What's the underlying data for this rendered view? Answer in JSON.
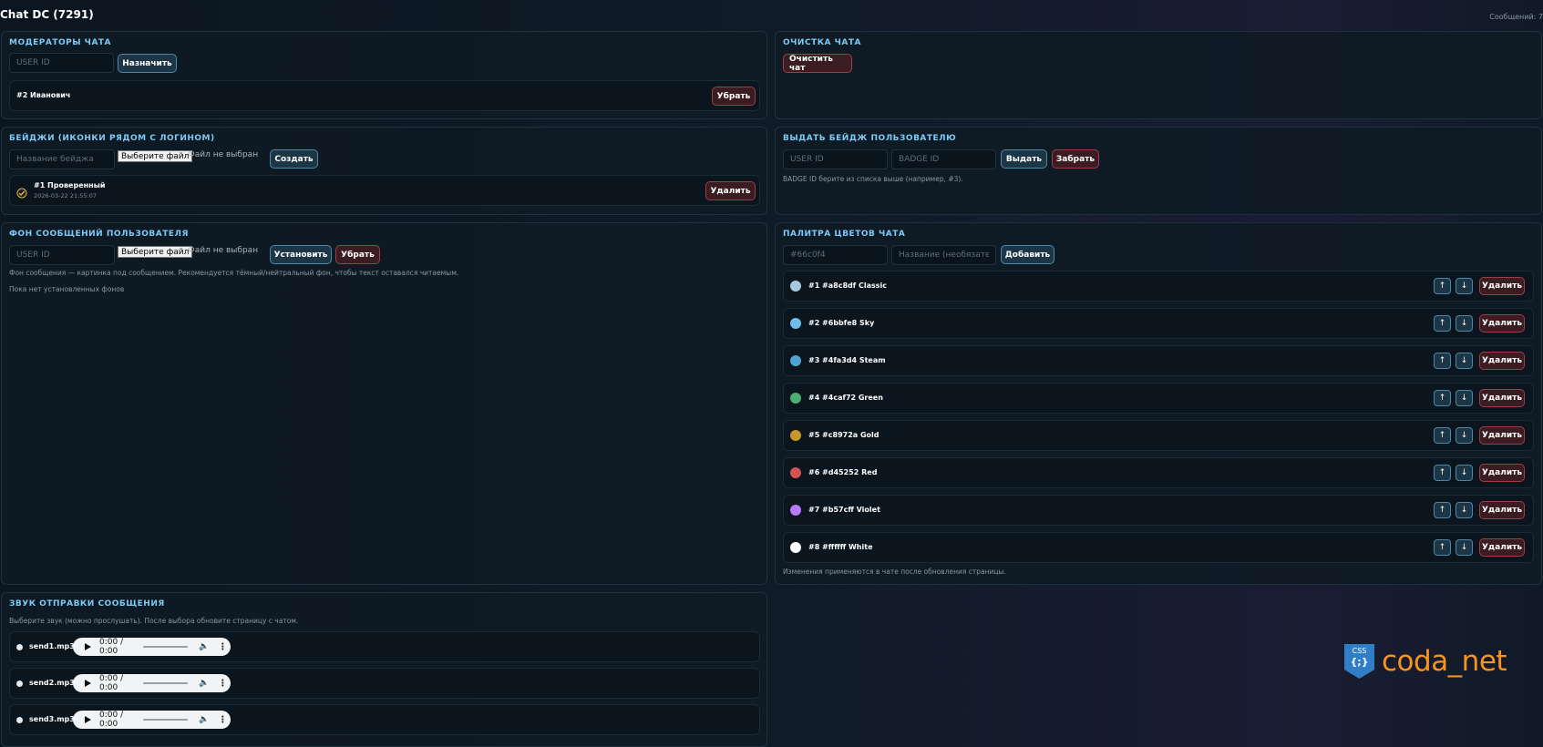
{
  "app": {
    "title": "Chat DC (7291)",
    "message_count": "Сообщений: 7"
  },
  "moderators": {
    "title": "МОДЕРАТОРЫ ЧАТА",
    "user_id_placeholder": "USER ID",
    "assign_label": "Назначить",
    "items": [
      {
        "label": "#2 Иванович",
        "remove_label": "Убрать"
      }
    ]
  },
  "clear_chat": {
    "title": "ОЧИСТКА ЧАТА",
    "button_label": "Очистить чат"
  },
  "badges": {
    "title": "БЕЙДЖИ (ИКОНКИ РЯДОМ С ЛОГИНОМ)",
    "name_placeholder": "Название бейджа",
    "file_button": "Выберите файл",
    "file_status": "Файл не выбран",
    "create_label": "Создать",
    "items": [
      {
        "label": "#1 Проверенный",
        "date": "2026-03-22 21:55:07",
        "delete_label": "Удалить"
      }
    ]
  },
  "give_badge": {
    "title": "ВЫДАТЬ БЕЙДЖ ПОЛЬЗОВАТЕЛЮ",
    "user_id_placeholder": "USER ID",
    "badge_id_placeholder": "BADGE ID",
    "give_label": "Выдать",
    "take_label": "Забрать",
    "hint": "BADGE ID берите из списка выше (например, #3)."
  },
  "message_bg": {
    "title": "ФОН СООБЩЕНИЙ ПОЛЬЗОВАТЕЛЯ",
    "user_id_placeholder": "USER ID",
    "file_button": "Выберите файл",
    "file_status": "Файл не выбран",
    "set_label": "Установить",
    "remove_label": "Убрать",
    "hint": "Фон сообщения — картинка под сообщением. Рекомендуется тёмный/нейтральный фон, чтобы текст оставался читаемым.",
    "empty": "Пока нет установленных фонов"
  },
  "palette": {
    "title": "ПАЛИТРА ЦВЕТОВ ЧАТА",
    "color_placeholder": "#66c0f4",
    "name_placeholder": "Название (необязательно)",
    "add_label": "Добавить",
    "up": "↑",
    "down": "↓",
    "delete_label": "Удалить",
    "items": [
      {
        "label": "#1 #a8c8df Classic",
        "color": "#a8c8df"
      },
      {
        "label": "#2 #6bbfe8 Sky",
        "color": "#6bbfe8"
      },
      {
        "label": "#3 #4fa3d4 Steam",
        "color": "#4fa3d4"
      },
      {
        "label": "#4 #4caf72 Green",
        "color": "#4caf72"
      },
      {
        "label": "#5 #c8972a Gold",
        "color": "#c8972a"
      },
      {
        "label": "#6 #d45252 Red",
        "color": "#d45252"
      },
      {
        "label": "#7 #b57cff Violet",
        "color": "#b57cff"
      },
      {
        "label": "#8 #ffffff White",
        "color": "#ffffff"
      }
    ],
    "footer": "Изменения применяются в чате после обновления страницы."
  },
  "sound": {
    "title": "ЗВУК ОТПРАВКИ СООБЩЕНИЯ",
    "hint": "Выберите звук (можно прослушать). После выбора обновите страницу с чатом.",
    "items": [
      {
        "label": "send1.mp3",
        "time": "0:00 / 0:00"
      },
      {
        "label": "send2.mp3",
        "time": "0:00 / 0:00"
      },
      {
        "label": "send3.mp3",
        "time": "0:00 / 0:00"
      }
    ]
  },
  "logo": {
    "badge": "CSS",
    "braces": "{;}",
    "text": "coda_net"
  },
  "colors": {
    "accent": "#7ec9f5",
    "danger": "#a03d45",
    "primary_border": "#4d88a8"
  }
}
